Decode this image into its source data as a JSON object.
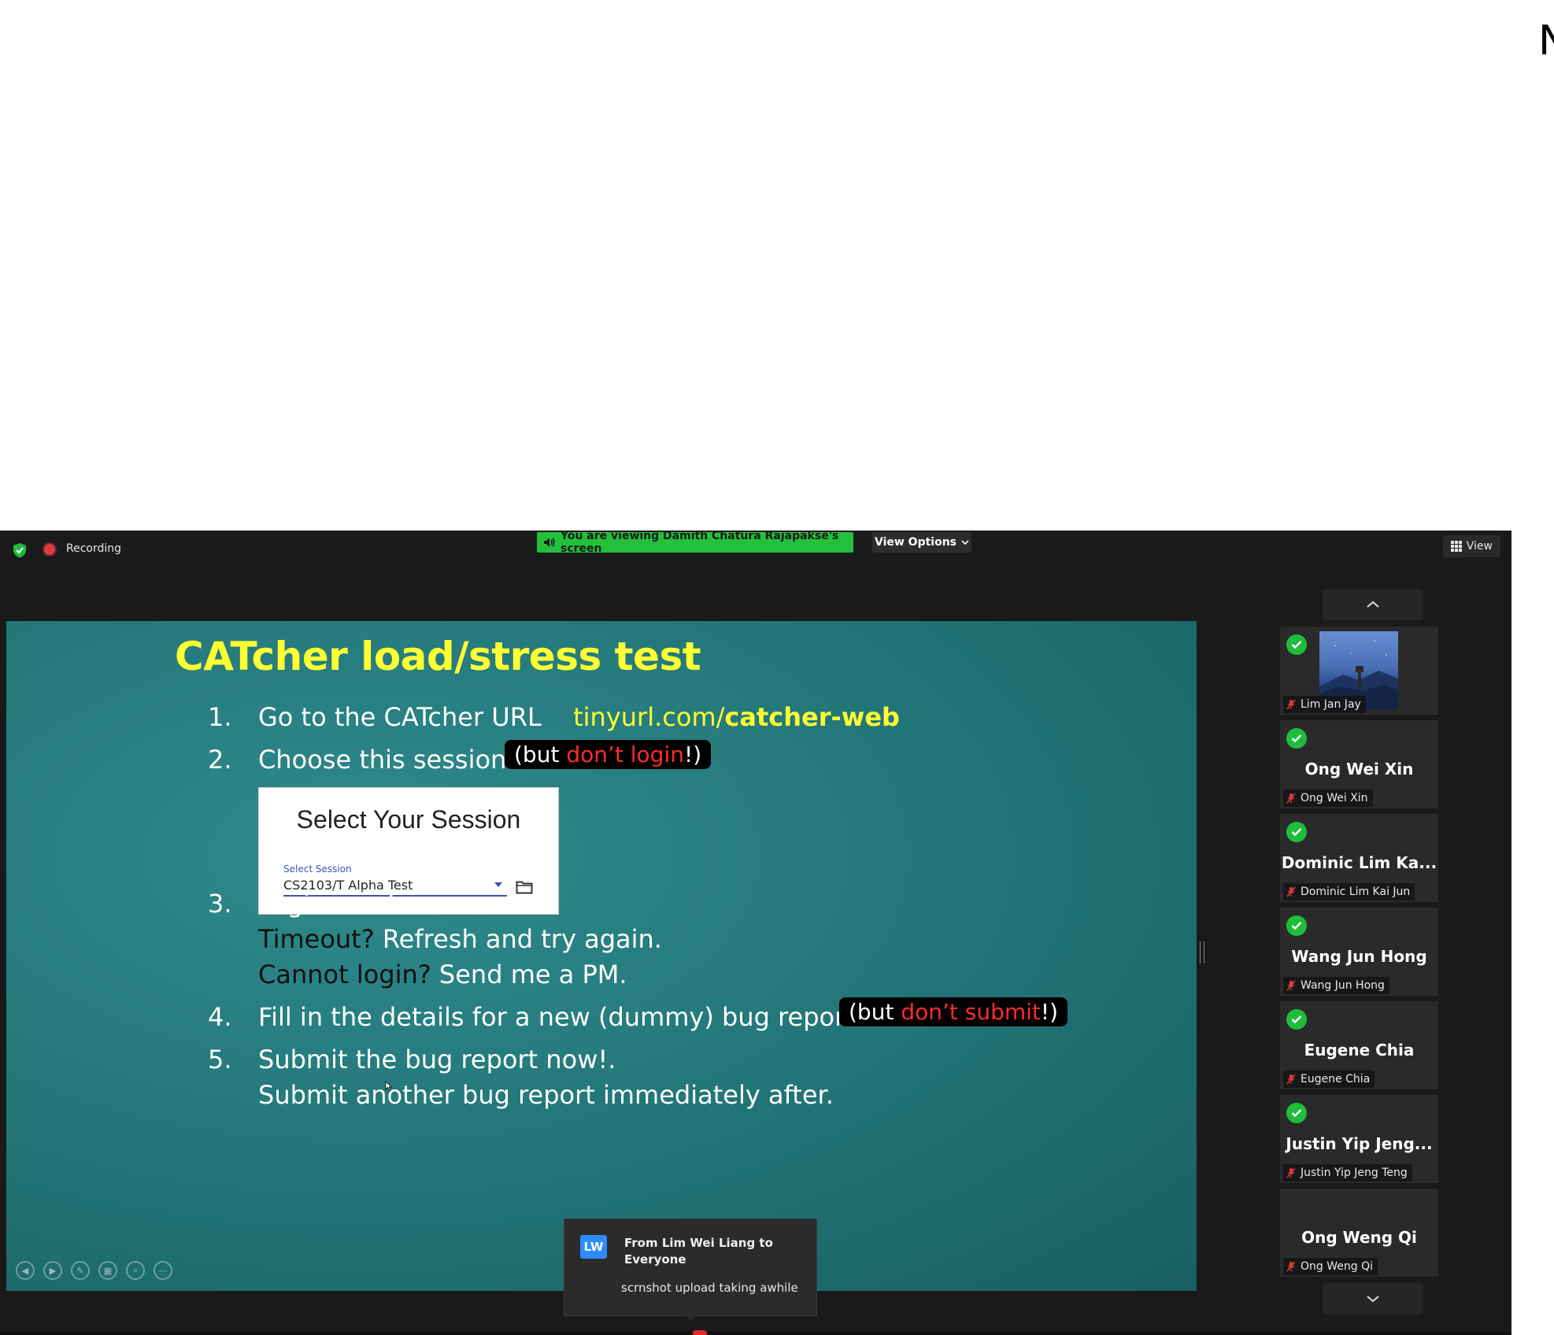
{
  "corner_glyph": "N",
  "topbar": {
    "recording_label": "Recording",
    "viewing_banner": "You are viewing Damith Chatura Rajapakse's screen",
    "view_options_label": "View Options",
    "view_label": "View"
  },
  "slide": {
    "title": "CATcher load/stress test",
    "steps": [
      {
        "num": "1.",
        "text": "Go to the CATcher URL",
        "link_prefix": "tinyurl.com/",
        "link_bold": "catcher-web"
      },
      {
        "num": "2.",
        "text": "Choose this session",
        "pill_open": "(but ",
        "pill_red": "don’t login",
        "pill_close": "!)"
      },
      {
        "num": "3.",
        "text": "Login now!",
        "line2_dark": "Timeout?",
        "line2_rest": " Refresh and try again.",
        "line3_dark": "Cannot login?",
        "line3_rest": " Send me a PM."
      },
      {
        "num": "4.",
        "text": "Fill in the details for a new (dummy) bug report.",
        "pill_open": "(but ",
        "pill_red": "don’t submit",
        "pill_close": "!)"
      },
      {
        "num": "5.",
        "text": "Submit the bug report now!.",
        "line2": "Submit another bug report immediately after."
      }
    ],
    "session_card": {
      "title": "Select Your Session",
      "label": "Select Session",
      "value": "CS2103/T Alpha Test"
    }
  },
  "chat": {
    "avatar": "LW",
    "from": "From Lim Wei Liang to Everyone",
    "message": "scrnshot upload taking awhile"
  },
  "participants": [
    {
      "display": "",
      "name": "Lim Jan Jay",
      "verified": true,
      "has_photo": true
    },
    {
      "display": "Ong Wei Xin",
      "name": "Ong Wei Xin",
      "verified": true
    },
    {
      "display": "Dominic Lim Ka...",
      "name": "Dominic Lim Kai Jun",
      "verified": true
    },
    {
      "display": "Wang Jun Hong",
      "name": "Wang Jun Hong",
      "verified": true
    },
    {
      "display": "Eugene Chia",
      "name": "Eugene Chia",
      "verified": true
    },
    {
      "display": "Justin Yip Jeng...",
      "name": "Justin Yip Jeng Teng",
      "verified": true
    },
    {
      "display": "Ong Weng Qi",
      "name": "Ong Weng Qi",
      "verified": false
    }
  ],
  "colors": {
    "banner_green": "#23c03b",
    "slide_teal": "#257a7c",
    "title_yellow": "#ffff33",
    "warning_red": "#ff2a2a"
  }
}
